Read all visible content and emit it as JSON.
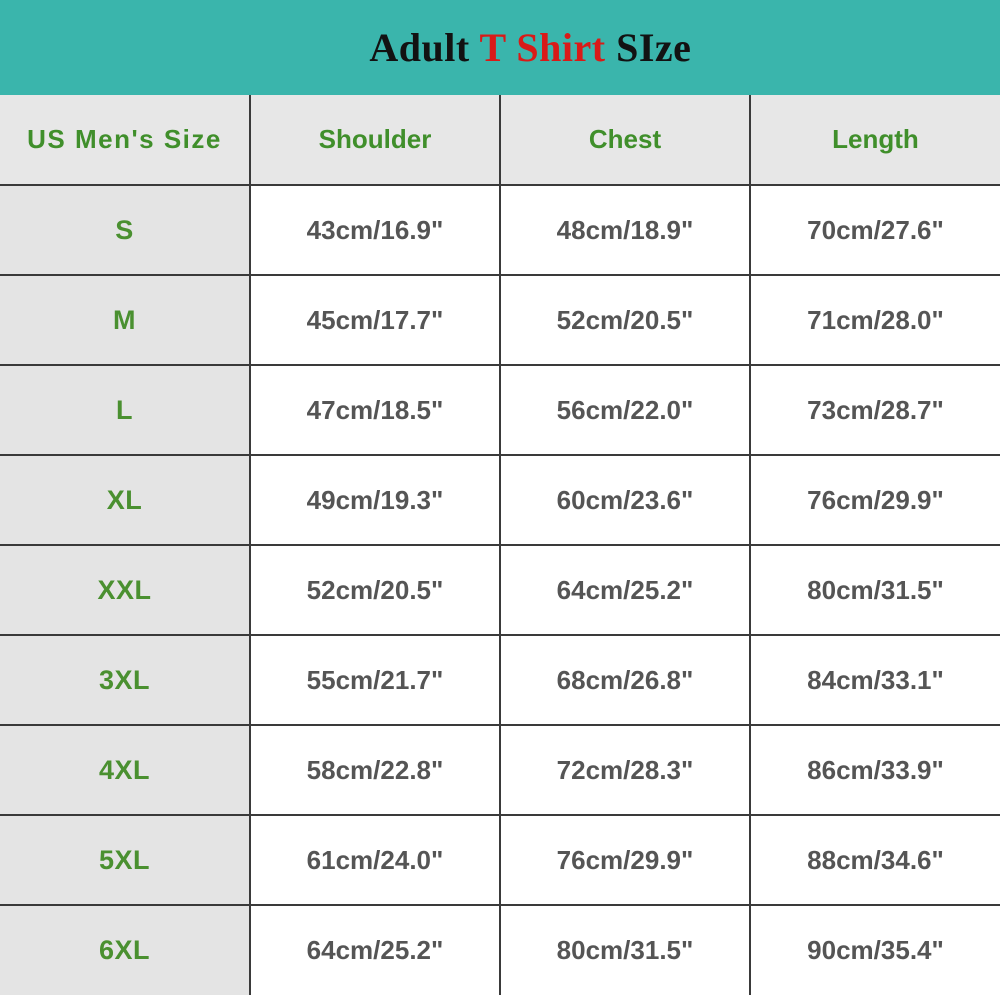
{
  "title": {
    "segments": [
      {
        "text": "Adult ",
        "color": "#121212"
      },
      {
        "text": "T Shirt",
        "color": "#d91a18"
      },
      {
        "text": " SIze",
        "color": "#121212"
      }
    ],
    "plain": "Adult T Shirt SIze",
    "banner_color": "#3ab5ac"
  },
  "colors": {
    "banner": "#3ab5ac",
    "header_text": "#408f2b",
    "header_bg": "#e7e7e7",
    "size_text": "#4a9030",
    "size_bg": "#e4e4e4",
    "value_text": "#555555",
    "accent_red": "#d91a18",
    "border": "#3a3a3a"
  },
  "table": {
    "headers": [
      "US  Men's  Size",
      "Shoulder",
      "Chest",
      "Length"
    ],
    "rows": [
      {
        "size": "S",
        "shoulder": "43cm/16.9\"",
        "chest": "48cm/18.9\"",
        "length": "70cm/27.6\""
      },
      {
        "size": "M",
        "shoulder": "45cm/17.7\"",
        "chest": "52cm/20.5\"",
        "length": "71cm/28.0\""
      },
      {
        "size": "L",
        "shoulder": "47cm/18.5\"",
        "chest": "56cm/22.0\"",
        "length": "73cm/28.7\""
      },
      {
        "size": "XL",
        "shoulder": "49cm/19.3\"",
        "chest": "60cm/23.6\"",
        "length": "76cm/29.9\""
      },
      {
        "size": "XXL",
        "shoulder": "52cm/20.5\"",
        "chest": "64cm/25.2\"",
        "length": "80cm/31.5\""
      },
      {
        "size": "3XL",
        "shoulder": "55cm/21.7\"",
        "chest": "68cm/26.8\"",
        "length": "84cm/33.1\""
      },
      {
        "size": "4XL",
        "shoulder": "58cm/22.8\"",
        "chest": "72cm/28.3\"",
        "length": "86cm/33.9\""
      },
      {
        "size": "5XL",
        "shoulder": "61cm/24.0\"",
        "chest": "76cm/29.9\"",
        "length": "88cm/34.6\""
      },
      {
        "size": "6XL",
        "shoulder": "64cm/25.2\"",
        "chest": "80cm/31.5\"",
        "length": "90cm/35.4\""
      }
    ]
  },
  "chart_data": {
    "type": "table",
    "title": "Adult T Shirt SIze",
    "columns": [
      "US Men's Size",
      "Shoulder",
      "Chest",
      "Length"
    ],
    "rows": [
      [
        "S",
        "43cm/16.9\"",
        "48cm/18.9\"",
        "70cm/27.6\""
      ],
      [
        "M",
        "45cm/17.7\"",
        "52cm/20.5\"",
        "71cm/28.0\""
      ],
      [
        "L",
        "47cm/18.5\"",
        "56cm/22.0\"",
        "73cm/28.7\""
      ],
      [
        "XL",
        "49cm/19.3\"",
        "60cm/23.6\"",
        "76cm/29.9\""
      ],
      [
        "XXL",
        "52cm/20.5\"",
        "64cm/25.2\"",
        "80cm/31.5\""
      ],
      [
        "3XL",
        "55cm/21.7\"",
        "68cm/26.8\"",
        "84cm/33.1\""
      ],
      [
        "4XL",
        "58cm/22.8\"",
        "72cm/28.3\"",
        "86cm/33.9\""
      ],
      [
        "5XL",
        "61cm/24.0\"",
        "76cm/29.9\"",
        "88cm/34.6\""
      ],
      [
        "6XL",
        "64cm/25.2\"",
        "80cm/31.5\"",
        "90cm/35.4\""
      ]
    ],
    "units": {
      "cm": "centimeters",
      "in": "inches"
    },
    "shoulder_cm": [
      43,
      45,
      47,
      49,
      52,
      55,
      58,
      61,
      64
    ],
    "shoulder_in": [
      16.9,
      17.7,
      18.5,
      19.3,
      20.5,
      21.7,
      22.8,
      24.0,
      25.2
    ],
    "chest_cm": [
      48,
      52,
      56,
      60,
      64,
      68,
      72,
      76,
      80
    ],
    "chest_in": [
      18.9,
      20.5,
      22.0,
      23.6,
      25.2,
      26.8,
      28.3,
      29.9,
      31.5
    ],
    "length_cm": [
      70,
      71,
      73,
      76,
      80,
      84,
      86,
      88,
      90
    ],
    "length_in": [
      27.6,
      28.0,
      28.7,
      29.9,
      31.5,
      33.1,
      33.9,
      34.6,
      35.4
    ]
  }
}
